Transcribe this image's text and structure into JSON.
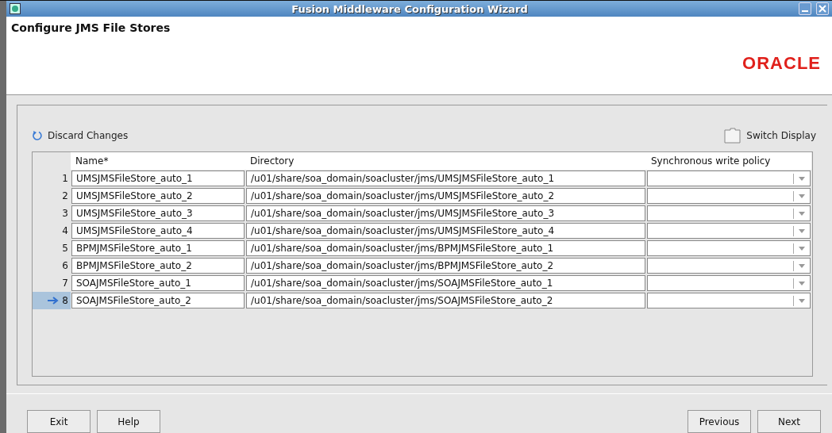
{
  "window": {
    "title": "Fusion Middleware Configuration Wizard"
  },
  "header": {
    "title": "Configure JMS File Stores",
    "logo": "ORACLE"
  },
  "toolbar": {
    "discard": {
      "label": "Discard Changes"
    },
    "switch_display": {
      "label": "Switch Display"
    }
  },
  "table": {
    "columns": [
      "Name*",
      "Directory",
      "Synchronous write policy"
    ],
    "rows": [
      {
        "number": "1",
        "name": "UMSJMSFileStore_auto_1",
        "directory": "/u01/share/soa_domain/soacluster/jms/UMSJMSFileStore_auto_1",
        "selected": false
      },
      {
        "number": "2",
        "name": "UMSJMSFileStore_auto_2",
        "directory": "/u01/share/soa_domain/soacluster/jms/UMSJMSFileStore_auto_2",
        "selected": false
      },
      {
        "number": "3",
        "name": "UMSJMSFileStore_auto_3",
        "directory": "/u01/share/soa_domain/soacluster/jms/UMSJMSFileStore_auto_3",
        "selected": false
      },
      {
        "number": "4",
        "name": "UMSJMSFileStore_auto_4",
        "directory": "/u01/share/soa_domain/soacluster/jms/UMSJMSFileStore_auto_4",
        "selected": false
      },
      {
        "number": "5",
        "name": "BPMJMSFileStore_auto_1",
        "directory": "/u01/share/soa_domain/soacluster/jms/BPMJMSFileStore_auto_1",
        "selected": false
      },
      {
        "number": "6",
        "name": "BPMJMSFileStore_auto_2",
        "directory": "/u01/share/soa_domain/soacluster/jms/BPMJMSFileStore_auto_2",
        "selected": false
      },
      {
        "number": "7",
        "name": "SOAJMSFileStore_auto_1",
        "directory": "/u01/share/soa_domain/soacluster/jms/SOAJMSFileStore_auto_1",
        "selected": false
      },
      {
        "number": "8",
        "name": "SOAJMSFileStore_auto_2",
        "directory": "/u01/share/soa_domain/soacluster/jms/SOAJMSFileStore_auto_2",
        "selected": true
      }
    ]
  },
  "buttons_left": [
    {
      "label": "Exit"
    },
    {
      "label": "Help"
    }
  ],
  "buttons_right": [
    {
      "label": "Previous"
    },
    {
      "label": "Next"
    }
  ]
}
